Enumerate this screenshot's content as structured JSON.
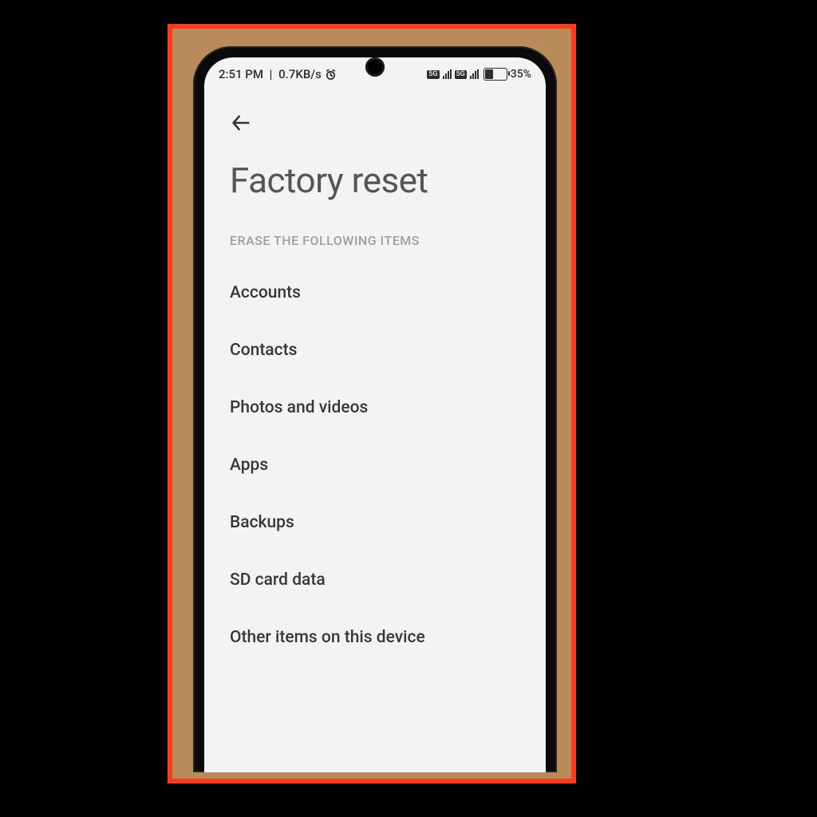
{
  "statusbar": {
    "time": "2:51 PM",
    "network_speed": "0.7KB/s",
    "alarm_icon": "alarm-icon",
    "sim1_type": "5G",
    "sim2_type": "5G",
    "battery_percent": "35%"
  },
  "page": {
    "title": "Factory reset",
    "section_label": "ERASE THE FOLLOWING ITEMS"
  },
  "items": [
    {
      "label": "Accounts"
    },
    {
      "label": "Contacts"
    },
    {
      "label": "Photos and videos"
    },
    {
      "label": "Apps"
    },
    {
      "label": "Backups"
    },
    {
      "label": "SD card data"
    },
    {
      "label": "Other items on this device"
    }
  ]
}
